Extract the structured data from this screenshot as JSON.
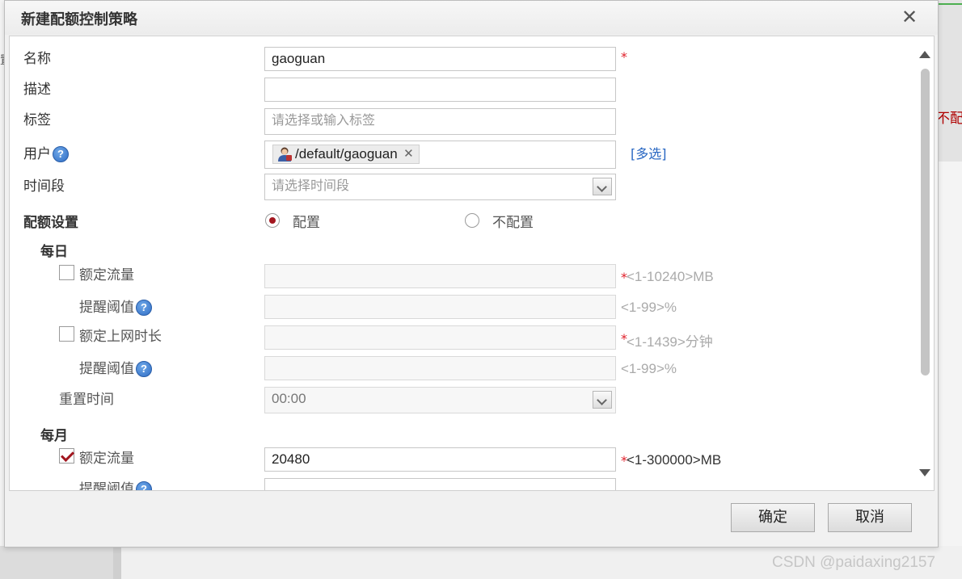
{
  "dialog": {
    "title": "新建配额控制策略",
    "close_symbol": "✕"
  },
  "form": {
    "name": {
      "label": "名称",
      "value": "gaoguan",
      "required_mark": "*"
    },
    "description": {
      "label": "描述",
      "value": ""
    },
    "tags": {
      "label": "标签",
      "placeholder": "请选择或输入标签"
    },
    "user": {
      "label": "用户",
      "help": "?",
      "chip_text": "/default/gaoguan",
      "chip_remove": "✕",
      "multi_select": "[多选]"
    },
    "time_period": {
      "label": "时间段",
      "placeholder": "请选择时间段"
    },
    "quota_settings": {
      "label": "配额设置",
      "options": [
        {
          "label": "配置",
          "checked": true
        },
        {
          "label": "不配置",
          "checked": false
        }
      ]
    },
    "daily": {
      "label": "每日",
      "traffic": {
        "label": "额定流量",
        "checked": false,
        "value": "",
        "required_mark": "*",
        "hint": "<1-10240>MB"
      },
      "traffic_alert": {
        "label": "提醒阈值",
        "help": "?",
        "value": "",
        "hint": "<1-99>%"
      },
      "online_time": {
        "label": "额定上网时长",
        "checked": false,
        "value": "",
        "required_mark": "*",
        "hint": "<1-1439>分钟"
      },
      "online_alert": {
        "label": "提醒阈值",
        "help": "?",
        "value": "",
        "hint": "<1-99>%"
      },
      "reset_time": {
        "label": "重置时间",
        "value": "00:00"
      }
    },
    "monthly": {
      "label": "每月",
      "traffic": {
        "label": "额定流量",
        "checked": true,
        "value": "20480",
        "required_mark": "*",
        "hint": "<1-300000>MB"
      },
      "traffic_alert": {
        "label": "提醒阈值",
        "help": "?"
      }
    }
  },
  "buttons": {
    "ok": "确定",
    "cancel": "取消"
  },
  "background": {
    "right_text": "不配置",
    "left_text": "置"
  },
  "watermark": "CSDN @paidaxing2157",
  "colors": {
    "accent_red": "#a2161f",
    "required_red": "#e0202a",
    "link_blue": "#2766c2",
    "hint_gray": "#aaaaaa"
  }
}
